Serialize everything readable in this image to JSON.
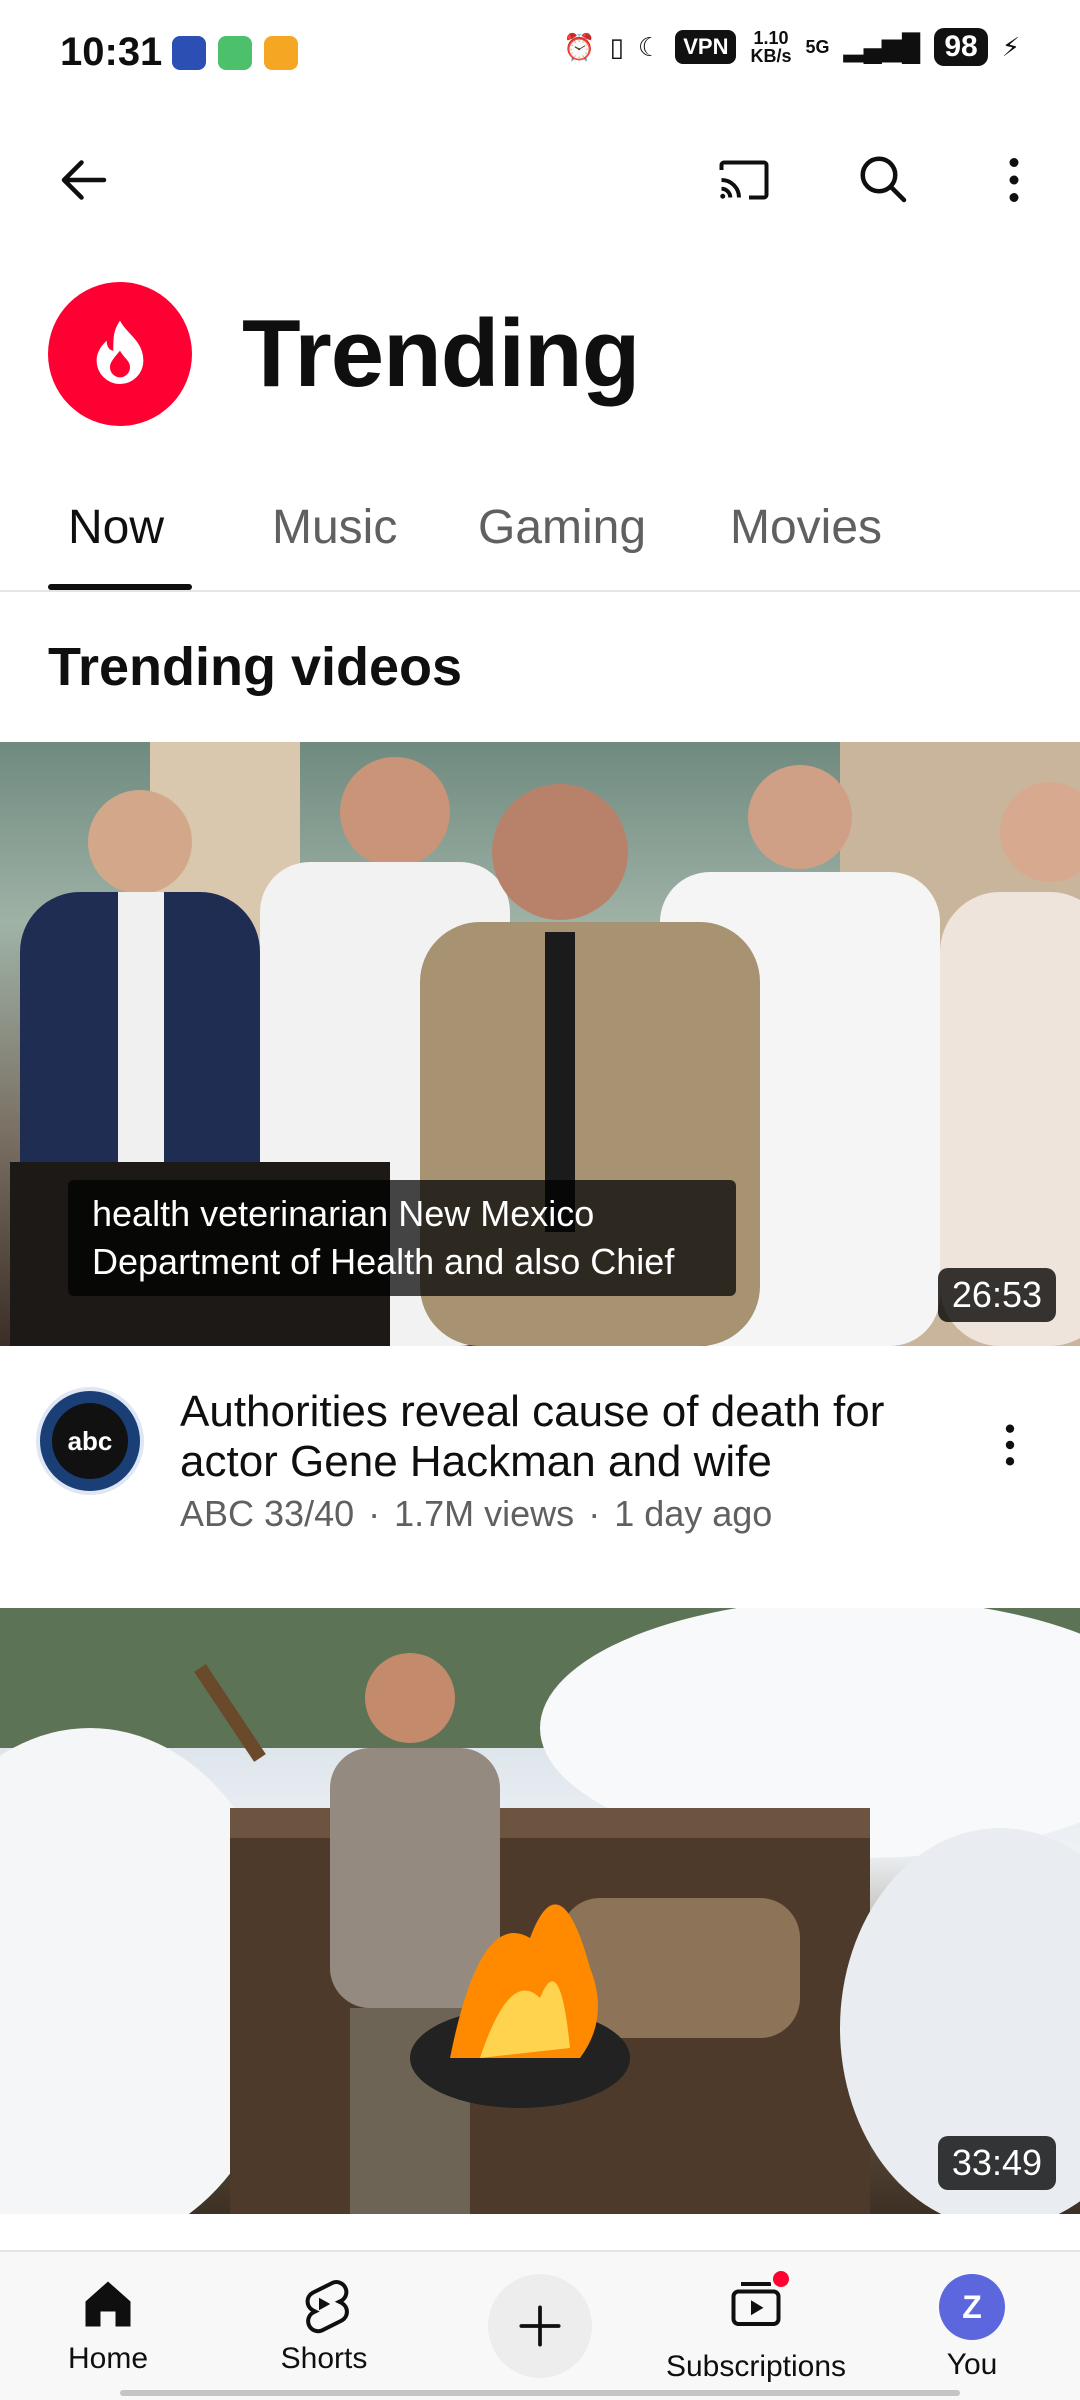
{
  "status_bar": {
    "time": "10:31",
    "vpn": "VPN",
    "speed_value": "1.10",
    "speed_unit": "KB/s",
    "network": "5G",
    "battery": "98"
  },
  "page": {
    "title": "Trending",
    "logo_color": "#ff0033"
  },
  "tabs": [
    {
      "label": "Now",
      "active": true
    },
    {
      "label": "Music",
      "active": false
    },
    {
      "label": "Gaming",
      "active": false
    },
    {
      "label": "Movies",
      "active": false
    }
  ],
  "section_title": "Trending videos",
  "videos": [
    {
      "caption_line1": "health veterinarian New Mexico",
      "caption_line2": "Department of Health and also Chief",
      "duration": "26:53",
      "channel_avatar_text": "abc",
      "title": "Authorities reveal cause of death for actor Gene Hackman and wife",
      "channel": "ABC 33/40",
      "views": "1.7M views",
      "age": "1 day ago"
    },
    {
      "duration": "33:49"
    }
  ],
  "bottom_nav": {
    "home": "Home",
    "shorts": "Shorts",
    "subscriptions": "Subscriptions",
    "you": "You",
    "you_avatar": "Z"
  },
  "icons": [
    "back-arrow-icon",
    "cast-icon",
    "search-icon",
    "more-vert-icon",
    "trending-flame-icon",
    "home-icon",
    "shorts-icon",
    "plus-icon",
    "subscriptions-icon"
  ]
}
